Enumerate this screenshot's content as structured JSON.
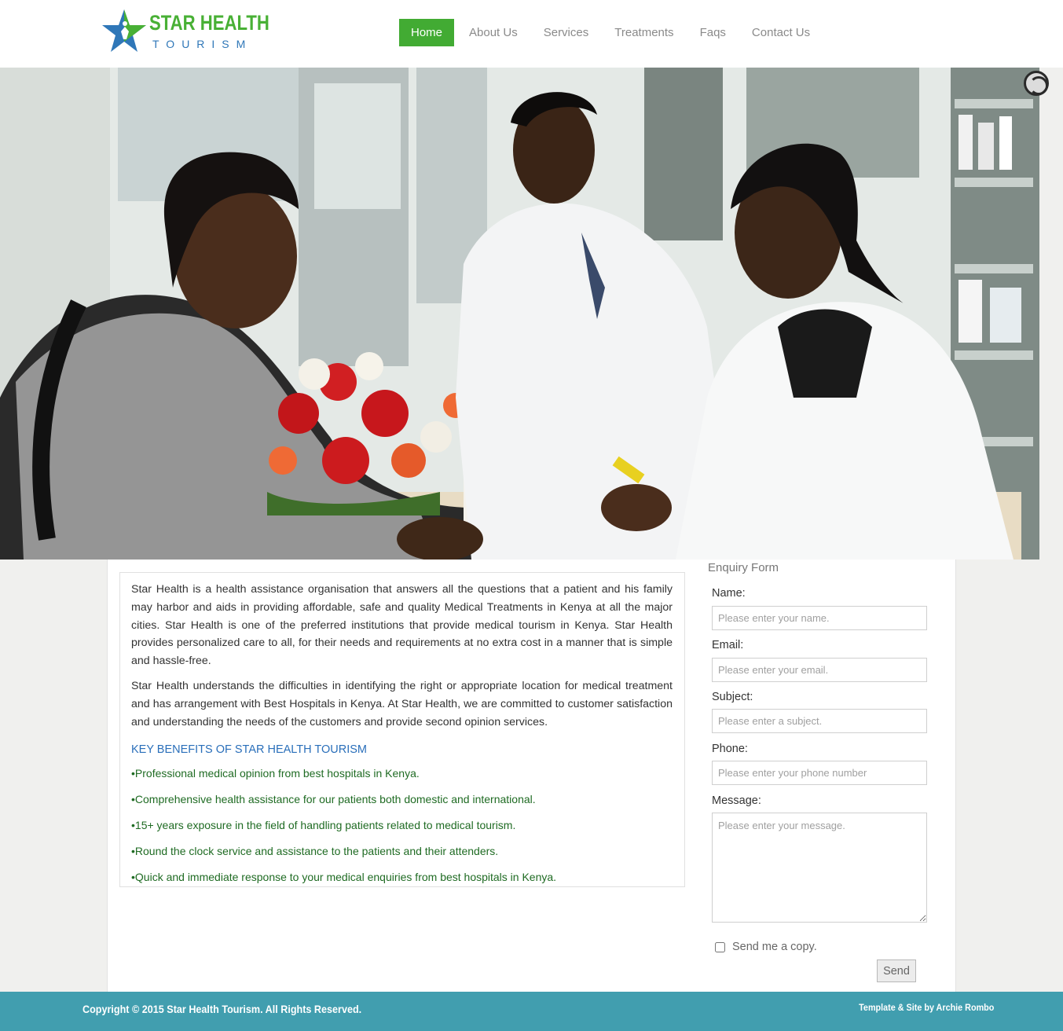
{
  "header": {
    "logo": {
      "line1": "STAR HEALTH",
      "line2": "TOURISM"
    },
    "nav": [
      {
        "label": "Home",
        "active": true
      },
      {
        "label": "About Us",
        "active": false
      },
      {
        "label": "Services",
        "active": false
      },
      {
        "label": "Treatments",
        "active": false
      },
      {
        "label": "Faqs",
        "active": false
      },
      {
        "label": "Contact Us",
        "active": false
      }
    ]
  },
  "hero": {
    "image": "photo-pharmacy-consultation",
    "loader_icon": "loading-spinner-icon"
  },
  "main": {
    "paragraphs": [
      "Star Health is a health assistance organisation that answers all the questions that a patient and his family may harbor and aids in providing affordable, safe and quality Medical Treatments in Kenya at all the major cities. Star Health is one of the preferred institutions that provide medical tourism in Kenya. Star Health provides personalized care to all, for their needs and requirements at no extra cost in a manner that is simple and hassle-free.",
      "Star Health understands the difficulties in identifying the right or appropriate location for medical treatment and has arrangement with Best Hospitals in Kenya. At Star Health, we are committed to customer satisfaction and understanding the needs of the customers and provide second opinion services."
    ],
    "benefits_heading": "KEY BENEFITS OF STAR HEALTH TOURISM",
    "benefits": [
      "•Professional medical opinion from best hospitals in Kenya.",
      "•Comprehensive health assistance for our patients both domestic and international.",
      "•15+ years exposure in the field of handling patients related to medical tourism.",
      "•Round the clock service and assistance to the patients and their attenders.",
      "•Quick and immediate response to your medical enquiries from best hospitals in Kenya."
    ]
  },
  "form": {
    "title": "Enquiry Form",
    "name_label": "Name:",
    "name_placeholder": "Please enter your name.",
    "email_label": "Email:",
    "email_placeholder": "Please enter your email.",
    "subject_label": "Subject:",
    "subject_placeholder": "Please enter a subject.",
    "phone_label": "Phone:",
    "phone_placeholder": "Please enter your phone number",
    "message_label": "Message:",
    "message_placeholder": "Please enter your message.",
    "copy_label": "Send me a copy.",
    "send_label": "Send"
  },
  "footer": {
    "copyright": "Copyright © 2015 Star Health Tourism. All Rights Reserved.",
    "credit": "Template & Site by Archie Rombo"
  },
  "colors": {
    "brand_green": "#42ab33",
    "brand_blue": "#2f77b8",
    "footer_teal": "#419eaf"
  }
}
